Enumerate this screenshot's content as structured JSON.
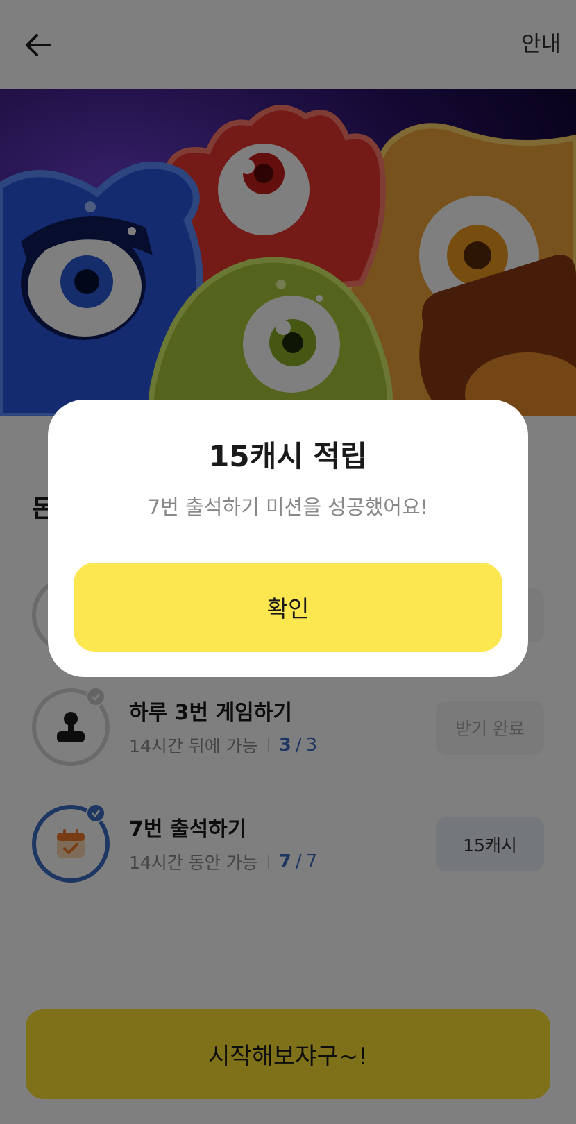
{
  "header": {
    "back_icon": "arrow-left-icon",
    "guide_label": "안내"
  },
  "section": {
    "title_partial": "돈"
  },
  "missions": [
    {
      "title": "하루 3번 게임하기",
      "availability": "14시간 뒤에 가능",
      "progress_current": "3",
      "progress_total": "3",
      "button_label": "받기 완료",
      "icon": "game-controller-icon",
      "status": "claimed"
    },
    {
      "title": "7번 출석하기",
      "availability": "14시간 동안 가능",
      "progress_current": "7",
      "progress_total": "7",
      "button_label": "15캐시",
      "icon": "calendar-check-icon",
      "status": "reward-ready"
    }
  ],
  "start_button": {
    "label": "시작해보쟈구~!"
  },
  "modal": {
    "title": "15캐시 적립",
    "message": "7번 출석하기 미션을 성공했어요!",
    "confirm_label": "확인"
  },
  "colors": {
    "accent_yellow": "#fde750",
    "start_yellow": "#ffe333",
    "progress_blue": "#3c6dc5",
    "overlay": "rgba(0,0,0,0.5)"
  }
}
